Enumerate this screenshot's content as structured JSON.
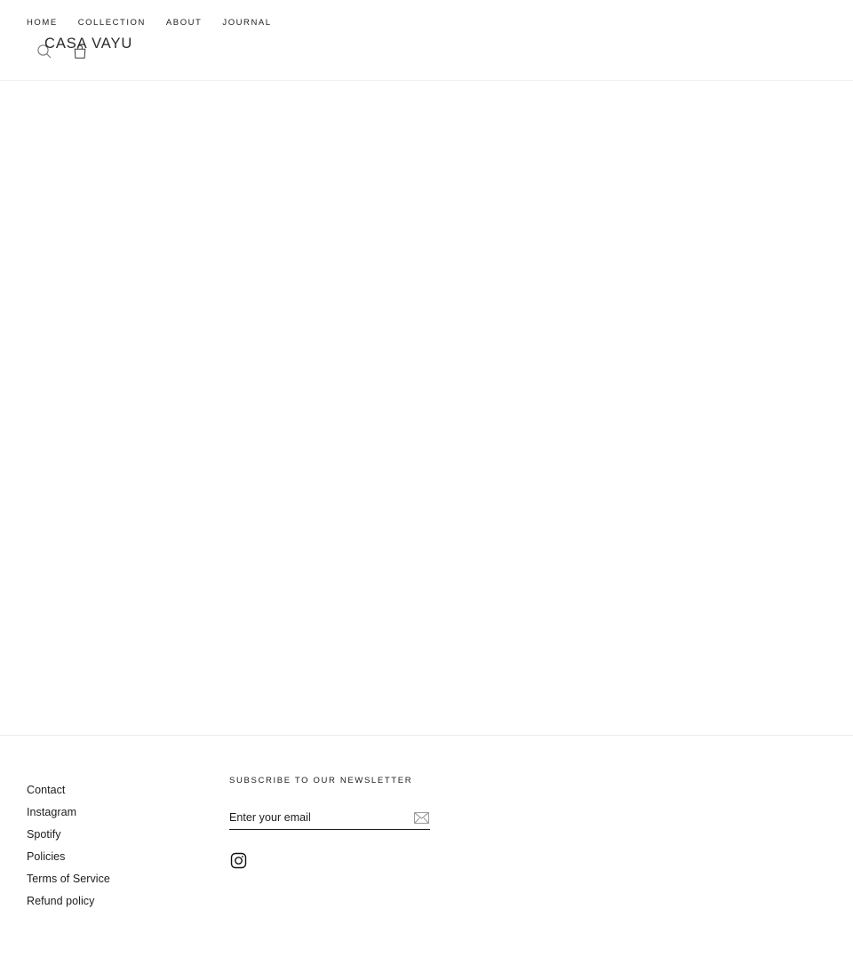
{
  "header": {
    "logo": "CASA VAYU",
    "nav": [
      {
        "label": "HOME"
      },
      {
        "label": "COLLECTION"
      },
      {
        "label": "ABOUT"
      },
      {
        "label": "JOURNAL"
      }
    ],
    "icons": {
      "search": "search-icon",
      "cart": "shopping-bag-icon"
    }
  },
  "main": {
    "content": ""
  },
  "footer": {
    "links": [
      {
        "label": "Contact"
      },
      {
        "label": "Instagram"
      },
      {
        "label": "Spotify"
      },
      {
        "label": "Policies"
      },
      {
        "label": "Terms of Service"
      },
      {
        "label": "Refund policy"
      }
    ],
    "newsletter": {
      "heading": "SUBSCRIBE TO OUR NEWSLETTER",
      "placeholder": "Enter your email",
      "value": "",
      "submit_icon": "envelope-icon"
    },
    "social": [
      {
        "name": "instagram",
        "icon": "instagram-icon"
      }
    ]
  },
  "colors": {
    "background": "#ffffff",
    "text": "#1c1c1c",
    "border": "#f0f0f0",
    "muted": "#8a8a8a"
  }
}
